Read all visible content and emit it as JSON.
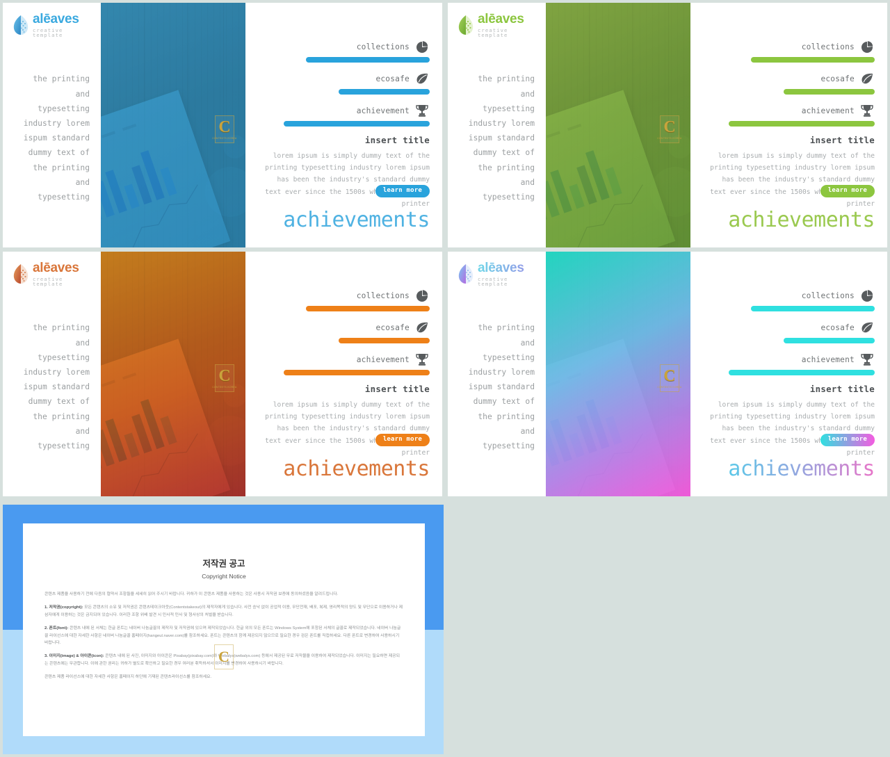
{
  "page": {
    "background_color": "#d6e0dd"
  },
  "brand": {
    "name": "alēaves",
    "tagline": "creative template",
    "logo_icon": "leaf-logo-icon"
  },
  "shared": {
    "left_paragraph": "the printing\nand\ntypesetting\nindustry lorem\nispum standard\ndummy text of\nthe printing\nand\ntypesetting",
    "stats": [
      {
        "label": "collections",
        "icon": "pie-chart-icon",
        "percent": 72
      },
      {
        "label": "ecosafe",
        "icon": "leaf-icon",
        "percent": 53
      },
      {
        "label": "achievement",
        "icon": "trophy-icon",
        "percent": 85
      }
    ],
    "insert_title": "insert title",
    "body_copy": "lorem ipsum is simply dummy text of the printing typesetting industry lorem ipsum has been the industry's standard dummy text ever since the 1500s when an unknown printer",
    "learn_more_label": "learn more",
    "headline": "achievements",
    "watermark": {
      "letter": "C",
      "sub": "CONTENTS KOREA"
    }
  },
  "slides": [
    {
      "id": "slide-blue",
      "theme_name": "blue",
      "accent": "#29a3dc",
      "accent_dark": "#1f93cc",
      "logo_color": "#3aa9df",
      "headline_color": "#4fb2e2",
      "photo_tint_from": "#2f9fd8",
      "photo_tint_to": "#2b93c9"
    },
    {
      "id": "slide-green",
      "theme_name": "green",
      "accent": "#8cc63f",
      "accent_dark": "#7cb431",
      "logo_color": "#8cc63f",
      "headline_color": "#9ac94f",
      "photo_tint_from": "#95c34a",
      "photo_tint_to": "#6fa83a"
    },
    {
      "id": "slide-orange",
      "theme_name": "orange",
      "accent": "#ee8018",
      "accent_dark": "#d96f10",
      "logo_color": "#d9763a",
      "headline_color": "#d9763a",
      "photo_tint_from": "#f0941f",
      "photo_tint_to": "#c03a32"
    },
    {
      "id": "slide-gradient",
      "theme_name": "cyan-magenta",
      "accent": "#2fe0e0",
      "accent_dark": "#22cccc",
      "logo_color": "#7fa6ea",
      "headline_color": "#63c8e8",
      "photo_tint_from": "#1fd7c4",
      "photo_tint_to": "#f45ce0"
    }
  ],
  "copyright_board": {
    "frame_top_color": "#4a9af0",
    "frame_bottom_color": "#b0dbfa",
    "title": "저작권 공고",
    "subtitle": "Copyright Notice",
    "intro": "콘텐츠 제품을 사용하기 전에 다음의 협약서 조항들을 세세히 읽어 주시기 바랍니다. 귀하가 이 콘텐츠 제품을 사용하는 것은 사용시 저작권 보증에 동의하셨음을 알려드립니다.",
    "sections": [
      {
        "heading": "1. 저작권(copyright):",
        "text": " 모든 콘텐츠의 소유 및 저작권은 콘텐츠테이크아웃(Contentstakeout)의 제작자에게 있습니다. 사전 승낙 없이 공업적 이용, 무단전재, 배포, 복제, 영리목적의 양도 및 무단으로 이용하거나 제삼자에게 이용하는 것은 금지되어 있습니다. 이러한 조항 위배 발견 시 민사적 민사 및 형사상의 처벌을 받습니다."
      },
      {
        "heading": "2. 폰트(font):",
        "text": " 콘텐츠 내에 된 서체는 한글 폰트는 네이버 나눔글꼴의 제작자 및 저작권에 있으며 제작되었습니다. 한글 외의 모든 폰트는 Windows System에 포함된 서체의 글꼴로 제작되었습니다. 네이버 나눔글꼴 라이선스에 대한 자세한 사항은 네이버 나눔글꼴 홈페이지(hangeul.naver.com)를 참조하세요. 폰트는 콘텐츠의 함께 제공되지 않으므로 필요한 경우 검은 폰트를 직접하세요. 다른 폰트로 변경하여 사용하시기 바랍니다."
      },
      {
        "heading": "3. 이미지(image) & 아이콘(icon):",
        "text": " 콘텐츠 내에 된 사진, 이미지와 아이콘은 Pixabay(pixabay.com)와 Webalys(webalys.com) 등에서 제공된 무료 저작물을 이용하여 제작되었습니다. 이미지는 필요하면 제공되는 콘텐츠에는 무관합니다. 이에 관한 권리는 귀하가 별도로 확인하고 필요한 경우 여러분 취득하셔서 이미지를 변경하여 사용하시기 바랍니다."
      }
    ],
    "footer": "콘텐츠 제품 라이선스에 대한 자세한 사항은 홈페이지 하단에 기재된 콘텐츠라이선스를 참조하세요.",
    "watermark_letter": "C"
  }
}
